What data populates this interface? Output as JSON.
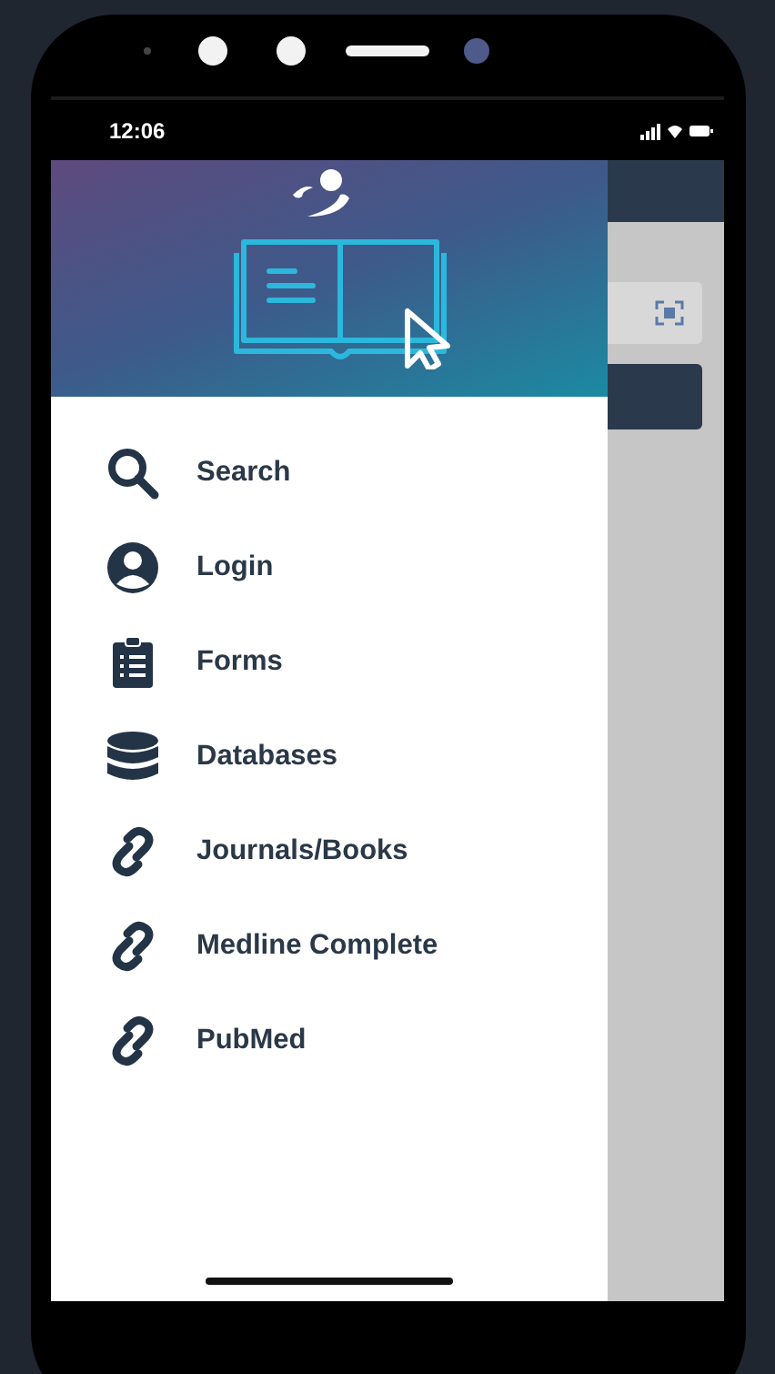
{
  "status_bar": {
    "time": "12:06"
  },
  "drawer": {
    "items": [
      {
        "label": "Search",
        "kind": "search",
        "selected": false
      },
      {
        "label": "Login",
        "kind": "user",
        "selected": false
      },
      {
        "label": "Forms",
        "kind": "clipboard",
        "selected": false
      },
      {
        "label": "Databases",
        "kind": "database",
        "selected": false
      },
      {
        "label": "Journals/Books",
        "kind": "link",
        "selected": false
      },
      {
        "label": "Medline Complete",
        "kind": "link",
        "selected": false
      },
      {
        "label": "PubMed",
        "kind": "link",
        "selected": false
      }
    ]
  }
}
